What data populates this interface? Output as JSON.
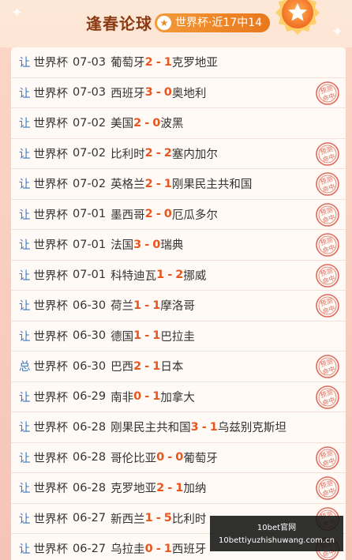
{
  "header": {
    "title": "逢春论球",
    "record": "世界杯·近17中14",
    "record_icon": "star-icon",
    "medal_icon": "star-medal-icon"
  },
  "colors": {
    "accent_orange": "#e8561e",
    "tag_blue": "#3a78c8",
    "stamp_red": "#e06a5a"
  },
  "stamp_text": [
    "预测",
    "命中"
  ],
  "matches": [
    {
      "tag": "让",
      "league": "世界杯",
      "date": "07-03",
      "home": "葡萄牙",
      "home_score": "2",
      "sep": "-",
      "away_score": "1",
      "away": "克罗地亚",
      "hit": false
    },
    {
      "tag": "让",
      "league": "世界杯",
      "date": "07-03",
      "home": "西班牙",
      "home_score": "3",
      "sep": "-",
      "away_score": "0",
      "away": "奥地利",
      "hit": true
    },
    {
      "tag": "让",
      "league": "世界杯",
      "date": "07-02",
      "home": "美国",
      "home_score": "2",
      "sep": "-",
      "away_score": "0",
      "away": "波黑",
      "hit": false
    },
    {
      "tag": "让",
      "league": "世界杯",
      "date": "07-02",
      "home": "比利时",
      "home_score": "2",
      "sep": "-",
      "away_score": "2",
      "away": "塞内加尔",
      "hit": true
    },
    {
      "tag": "让",
      "league": "世界杯",
      "date": "07-02",
      "home": "英格兰",
      "home_score": "2",
      "sep": "-",
      "away_score": "1",
      "away": "刚果民主共和国",
      "hit": true
    },
    {
      "tag": "让",
      "league": "世界杯",
      "date": "07-01",
      "home": "墨西哥",
      "home_score": "2",
      "sep": "-",
      "away_score": "0",
      "away": "厄瓜多尔",
      "hit": true
    },
    {
      "tag": "让",
      "league": "世界杯",
      "date": "07-01",
      "home": "法国",
      "home_score": "3",
      "sep": "-",
      "away_score": "0",
      "away": "瑞典",
      "hit": true
    },
    {
      "tag": "让",
      "league": "世界杯",
      "date": "07-01",
      "home": "科特迪瓦",
      "home_score": "1",
      "sep": "-",
      "away_score": "2",
      "away": "挪威",
      "hit": true
    },
    {
      "tag": "让",
      "league": "世界杯",
      "date": "06-30",
      "home": "荷兰",
      "home_score": "1",
      "sep": "-",
      "away_score": "1",
      "away": "摩洛哥",
      "hit": true
    },
    {
      "tag": "让",
      "league": "世界杯",
      "date": "06-30",
      "home": "德国",
      "home_score": "1",
      "sep": "-",
      "away_score": "1",
      "away": "巴拉圭",
      "hit": false
    },
    {
      "tag": "总",
      "league": "世界杯",
      "date": "06-30",
      "home": "巴西",
      "home_score": "2",
      "sep": "-",
      "away_score": "1",
      "away": "日本",
      "hit": true
    },
    {
      "tag": "让",
      "league": "世界杯",
      "date": "06-29",
      "home": "南非",
      "home_score": "0",
      "sep": "-",
      "away_score": "1",
      "away": "加拿大",
      "hit": true
    },
    {
      "tag": "让",
      "league": "世界杯",
      "date": "06-28",
      "home": "刚果民主共和国",
      "home_score": "3",
      "sep": "-",
      "away_score": "1",
      "away": "乌兹别克斯坦",
      "hit": false
    },
    {
      "tag": "让",
      "league": "世界杯",
      "date": "06-28",
      "home": "哥伦比亚",
      "home_score": "0",
      "sep": "-",
      "away_score": "0",
      "away": "葡萄牙",
      "hit": true
    },
    {
      "tag": "让",
      "league": "世界杯",
      "date": "06-28",
      "home": "克罗地亚",
      "home_score": "2",
      "sep": "-",
      "away_score": "1",
      "away": "加纳",
      "hit": true
    },
    {
      "tag": "让",
      "league": "世界杯",
      "date": "06-27",
      "home": "新西兰",
      "home_score": "1",
      "sep": "-",
      "away_score": "5",
      "away": "比利时",
      "hit": true
    },
    {
      "tag": "让",
      "league": "世界杯",
      "date": "06-27",
      "home": "乌拉圭",
      "home_score": "0",
      "sep": "-",
      "away_score": "1",
      "away": "西班牙",
      "hit": true
    }
  ],
  "watermark": {
    "line1": "10bet官网",
    "line2": "10bettiyuzhishuwang.com.cn"
  }
}
